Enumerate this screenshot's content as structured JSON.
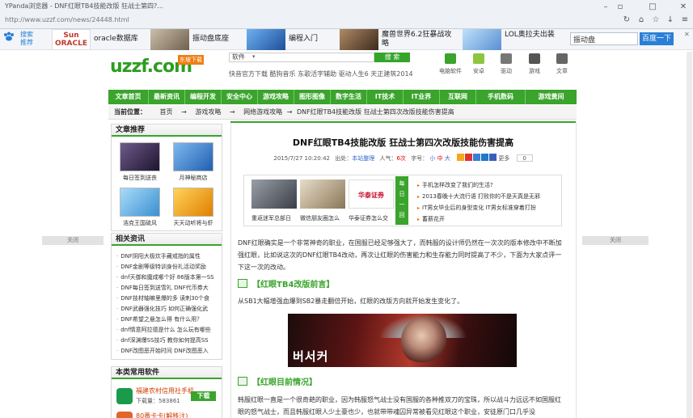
{
  "browser": {
    "title": "YPanda浏览器 - DNF红眼TB4技能改版 狂战士第四?...",
    "url": "http://www.uzzf.com/news/24448.html"
  },
  "adbar": {
    "left_label": "搜索\n推荐",
    "items": [
      {
        "brand": "Sun\nORACLE",
        "text": "oracle数据库",
        "color": "#c0392b"
      },
      {
        "text": "振动盘底座",
        "color": "#8a7b66"
      },
      {
        "text": "编程入门",
        "color": "#2d6fb7"
      },
      {
        "text": "魔兽世界6.2狂暴战攻略",
        "color": "#7a5a3a"
      },
      {
        "text": "LOL奥拉夫出装",
        "color": "#5aa0d8"
      }
    ],
    "search_value": "振动盘",
    "search_button": "百度一下"
  },
  "site": {
    "logo_text": "uzzf.com",
    "logo_badge": "东坡下载",
    "search_placeholder": "软件",
    "search_button": "搜 索",
    "hot_words": "快音官方下载  酷狗音乐  东歌活字辅助  驱动人生6  天正建筑2014",
    "top_icons": [
      {
        "label": "电脑软件",
        "icon": "pc-icon",
        "color": "#3aa42c"
      },
      {
        "label": "安卓",
        "icon": "android-icon",
        "color": "#8cc63f"
      },
      {
        "label": "驱动",
        "icon": "driver-icon",
        "color": "#777777"
      },
      {
        "label": "游戏",
        "icon": "gamepad-icon",
        "color": "#555555"
      },
      {
        "label": "文章",
        "icon": "article-icon",
        "color": "#666666"
      }
    ],
    "nav": [
      "文章首页",
      "最新资讯",
      "编程开发",
      "安全中心",
      "游戏攻略",
      "图形图像",
      "数字生活",
      "IT技术",
      "IT业界",
      "互联网",
      "手机数码",
      "游戏黄间"
    ],
    "breadcrumb": {
      "label": "当前位置：",
      "items": [
        "首页",
        "→",
        "游戏攻略",
        "→",
        "网络游戏攻略",
        "→",
        "DNF红眼TB4技能改版 狂战士第四次改版技能伤害提高"
      ]
    }
  },
  "left": {
    "recommend_title": "文章推荐",
    "recommend": [
      {
        "caption": "每日签到送丧",
        "color": "#3a2b52"
      },
      {
        "caption": "月神秘商店",
        "color": "#2f77c9"
      },
      {
        "caption": "浩克王国硫风",
        "color": "#4aa3e0"
      },
      {
        "caption": "天天动听将与虾",
        "color": "#e7a100"
      }
    ],
    "related_title": "相关资讯",
    "related": [
      "DNF阴阳大极炊手藏戒指的属性",
      "DNF金剧等级特训身份礼活动奖励",
      "dnf天御和魔咸哪个好  86版本第一SS",
      "DNF每日签到送雪礼  DNF代币券大",
      "DNF技材轴嘛里爆的多  读刺30个食",
      "DNF武器强化技巧  如何正确强化武",
      "DNF希望之悬怎么得  有什么用？",
      "dnf情意阿拉德是什么  怎么玩有哪些",
      "dnf深渊爆SS技巧  教你如何提高SS",
      "DNF改图恶开始时间  DNF改图恶入"
    ],
    "software_title": "本类常用软件",
    "software": [
      {
        "name": "福建农村信用社手机",
        "meta": "下载量：583861",
        "button": "下载",
        "color": "#1a9a4a"
      },
      {
        "name": "80番卡卡(解移注)",
        "color": "#e3652b"
      }
    ]
  },
  "article": {
    "title": "DNF红眼TB4技能改版  狂战士第四次改版技能伤害提高",
    "meta": {
      "date": "2015/7/27 10:20:42",
      "source_label": "出处：",
      "source": "本站整理",
      "views_label": "人气：",
      "views": "6次",
      "font_label": "字号：",
      "font_small": "小",
      "font_mid": "中",
      "font_big": "大",
      "more": "更多",
      "count": "0"
    },
    "featured": [
      {
        "caption": "重返迷军总部日",
        "color": "#6d7178"
      },
      {
        "caption": "微信朋友圈怎么",
        "color": "#b7a58a"
      },
      {
        "caption": "华泰证券怎么交",
        "brand": "华泰证券",
        "color": "#c8102e"
      }
    ],
    "daily_tag": "每\n日\n一\n回",
    "daily": [
      "手机怎样改变了我们的生活?",
      "2013春晚十大流行语  打败你的不是天真是无邪",
      "IT男女毕业后的身型变化  IT男女标准穿着打扮",
      "蓄薪花开"
    ],
    "intro": "DNF红眼确实是一个非常神奇的职业，在国服已经足够强大了，而韩服的设计师仍然在一次次的版本修改中不断加强红眼，比如说这次的DNF红眼TB4改动，再次让红眼的伤害能力和生存能力同时提高了不少，下面为大家点评一下这一次的改动。",
    "section1": "【红眼TB4改版前言】",
    "section1_text": "从SB1大幅增强血爆到SB2暴走翻倍开始，红眼的改版方向就开始发生变化了。",
    "image_caption": "버서커",
    "section2": "【红眼目前情况】",
    "section2_text": "韩服红眼一直是一个很奇葩的职业，因为韩服怒气战士没有国服的各种推双刀的宝珠，所以战斗力远远不如国服红眼的怒气战士，而且韩服红眼人少土豪也少，也就带带魂囚异常被看见红眼这个职业，安徒原门口几乎没"
  },
  "side": {
    "close_label": "关闭"
  }
}
